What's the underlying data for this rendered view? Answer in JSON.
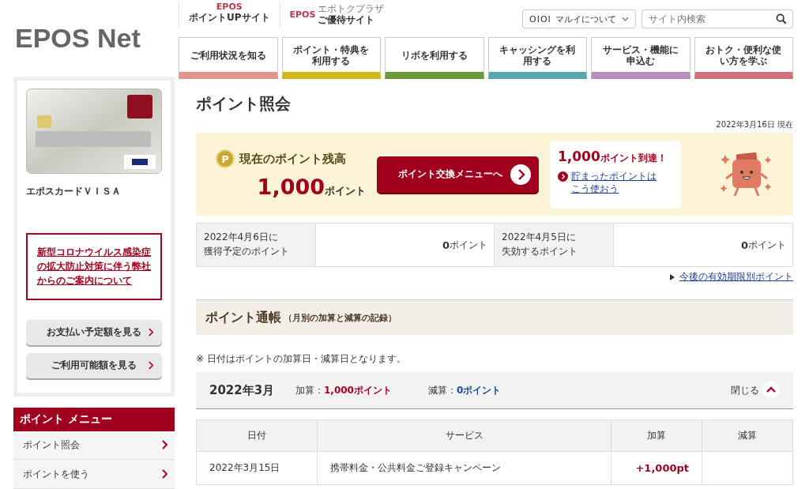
{
  "header": {
    "logo": "EPOS Net",
    "sub_sites": [
      {
        "logo": "EPOS",
        "label": "ポイントUPサイト"
      },
      {
        "logo": "EPOS",
        "small": "エポトクプラザ",
        "label": "ご優待サイト"
      }
    ],
    "marui": {
      "logo": "OIOI",
      "label": "マルイについて"
    },
    "search": {
      "placeholder": "サイト内検索"
    }
  },
  "nav": [
    {
      "label": "ご利用状況を知る",
      "color": "#e0968a"
    },
    {
      "label": "ポイント・特典を利用する",
      "color": "#d4b820"
    },
    {
      "label": "リボを利用する",
      "color": "#6f9a3c"
    },
    {
      "label": "キャッシングを利用する",
      "color": "#5aa4b4"
    },
    {
      "label": "サービス・機能に申込む",
      "color": "#b98fbf"
    },
    {
      "label": "おトク・便利な使い方を学ぶ",
      "color": "#d0707c"
    }
  ],
  "sidebar": {
    "card_name": "エポスカードＶＩＳＡ",
    "notice": "新型コロナウイルス感染症の拡大防止対策に伴う弊社からのご案内について",
    "buttons": [
      "お支払い予定額を見る",
      "ご利用可能額を見る"
    ],
    "menu_title": "ポイント メニュー",
    "menu": [
      {
        "label": "ポイント照会",
        "selected": false
      },
      {
        "label": "ポイントを使う",
        "selected": false
      }
    ]
  },
  "main": {
    "title": "ポイント照会",
    "as_of": "2022年3月16日 現在",
    "balance": {
      "icon": "P",
      "label": "現在のポイント残高",
      "amount": "1,000",
      "unit": "ポイント",
      "button": "ポイント交換メニューへ"
    },
    "promo": {
      "amount": "1,000",
      "text": "ポイント到達！",
      "link": [
        "貯まったポイントは",
        "こう使おう"
      ]
    },
    "summary": [
      {
        "label": [
          "2022年4月6日に",
          "獲得予定のポイント"
        ],
        "value": "0",
        "unit": "ポイント"
      },
      {
        "label": [
          "2022年4月5日に",
          "失効するポイント"
        ],
        "value": "0",
        "unit": "ポイント"
      }
    ],
    "expiry_link": "今後の有効期限別ポイント",
    "passbook": {
      "title": "ポイント通帳",
      "subtitle": "（月別の加算と減算の記録）",
      "note": "※ 日付はポイントの加算日・減算日となります。",
      "month": "2022年3月",
      "add_label": "加算：",
      "add_value": "1,000",
      "add_unit": "ポイント",
      "sub_label": "減算：",
      "sub_value": "0",
      "sub_unit": "ポイント",
      "toggle": "閉じる",
      "expanded": true,
      "columns": [
        "日付",
        "サービス",
        "加算",
        "減算"
      ],
      "rows": [
        {
          "date": "2022年3月15日",
          "service": "携帯料金・公共料金ご登録キャンペーン",
          "add": "+1,000pt"
        }
      ]
    }
  }
}
